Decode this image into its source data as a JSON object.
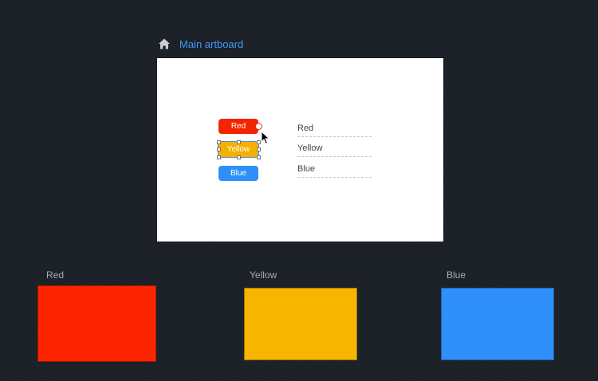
{
  "header": {
    "title": "Main artboard",
    "icon": "home-icon"
  },
  "artboard": {
    "buttons": [
      {
        "label": "Red",
        "color": "#f52400"
      },
      {
        "label": "Yellow",
        "color": "#f5b000"
      },
      {
        "label": "Blue",
        "color": "#2e8ff7"
      }
    ],
    "list": [
      "Red",
      "Yellow",
      "Blue"
    ]
  },
  "swatches": [
    {
      "label": "Red",
      "color": "#fc2500"
    },
    {
      "label": "Yellow",
      "color": "#f8b500"
    },
    {
      "label": "Blue",
      "color": "#2f8ffb"
    }
  ]
}
